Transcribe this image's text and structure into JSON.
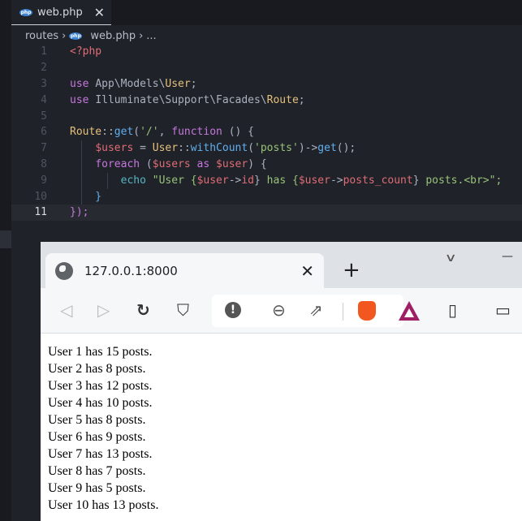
{
  "editor": {
    "tab": {
      "label": "web.php",
      "icon": "php-icon"
    },
    "breadcrumb": [
      "routes",
      "web.php",
      "..."
    ],
    "current_line": 11,
    "lines": [
      [
        [
          "<?php",
          "red"
        ]
      ],
      [],
      [
        [
          "use ",
          "purple"
        ],
        [
          "App\\Models\\",
          "plain"
        ],
        [
          "User",
          "yellow"
        ],
        [
          ";",
          "plain"
        ]
      ],
      [
        [
          "use ",
          "purple"
        ],
        [
          "Illuminate\\Support\\Facades\\",
          "plain"
        ],
        [
          "Route",
          "yellow"
        ],
        [
          ";",
          "plain"
        ]
      ],
      [],
      [
        [
          "Route",
          "yellow"
        ],
        [
          "::",
          "plain"
        ],
        [
          "get",
          "blue"
        ],
        [
          "(",
          "plain"
        ],
        [
          "'/'",
          "green"
        ],
        [
          ", ",
          "plain"
        ],
        [
          "function",
          "purple"
        ],
        [
          " () {",
          "plain"
        ]
      ],
      [
        [
          "    ",
          "plain"
        ],
        [
          "$users",
          "var"
        ],
        [
          " = ",
          "plain"
        ],
        [
          "User",
          "yellow"
        ],
        [
          "::",
          "plain"
        ],
        [
          "withCount",
          "blue"
        ],
        [
          "(",
          "plain"
        ],
        [
          "'posts'",
          "green"
        ],
        [
          ")->",
          "plain"
        ],
        [
          "get",
          "blue"
        ],
        [
          "();",
          "plain"
        ]
      ],
      [
        [
          "    ",
          "plain"
        ],
        [
          "foreach",
          "purple"
        ],
        [
          " (",
          "plain"
        ],
        [
          "$users",
          "var"
        ],
        [
          " as ",
          "purple"
        ],
        [
          "$user",
          "var"
        ],
        [
          ") {",
          "plain"
        ]
      ],
      [
        [
          "        ",
          "plain"
        ],
        [
          "echo",
          "cyan"
        ],
        [
          " \"User {",
          "green"
        ],
        [
          "$user",
          "var"
        ],
        [
          "->",
          "plain"
        ],
        [
          "id",
          "red"
        ],
        [
          "}",
          "plain"
        ],
        [
          " has {",
          "green"
        ],
        [
          "$user",
          "var"
        ],
        [
          "->",
          "plain"
        ],
        [
          "posts_count",
          "red"
        ],
        [
          "}",
          "plain"
        ],
        [
          " posts.<br>\";",
          "green"
        ]
      ],
      [
        [
          "    }",
          "blue"
        ]
      ],
      [
        [
          "});",
          "purple"
        ]
      ]
    ]
  },
  "browser": {
    "tab_title": "127.0.0.1:8000",
    "close": "✕",
    "new_tab": "+",
    "tab_list": "∨",
    "minimize": "—",
    "output": [
      "User 1 has 15 posts.",
      "User 2 has 8 posts.",
      "User 3 has 12 posts.",
      "User 4 has 10 posts.",
      "User 5 has 8 posts.",
      "User 6 has 9 posts.",
      "User 7 has 13 posts.",
      "User 8 has 7 posts.",
      "User 9 has 5 posts.",
      "User 10 has 13 posts."
    ]
  }
}
